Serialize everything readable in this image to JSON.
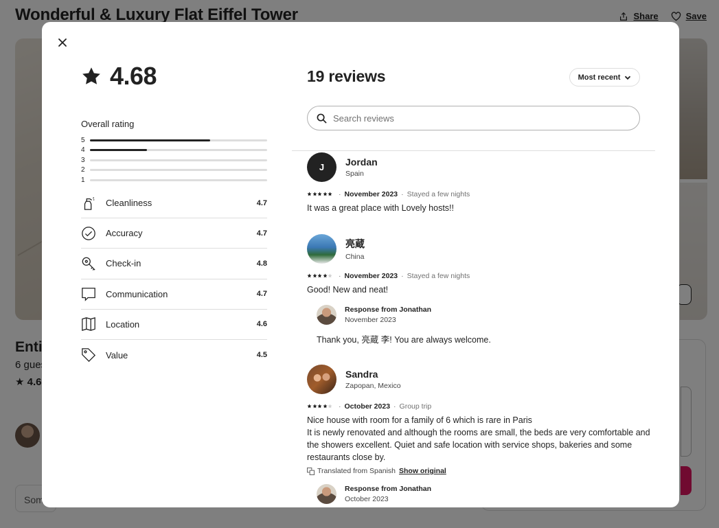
{
  "listing": {
    "title": "Wonderful & Luxury Flat Eiffel Tower",
    "share_label": "Share",
    "save_label": "Save",
    "entire_partial": "Entir",
    "guests_partial": "6 gues",
    "rating_partial": "4.6",
    "some_partial": "Som"
  },
  "modal": {
    "close_icon": "close-icon",
    "overall_score": "4.68",
    "overall_label": "Overall rating",
    "distribution": [
      {
        "stars": "5",
        "fraction": 0.68
      },
      {
        "stars": "4",
        "fraction": 0.32
      },
      {
        "stars": "3",
        "fraction": 0
      },
      {
        "stars": "2",
        "fraction": 0
      },
      {
        "stars": "1",
        "fraction": 0
      }
    ],
    "categories": [
      {
        "label": "Cleanliness",
        "value": "4.7",
        "icon": "spray-bottle-icon"
      },
      {
        "label": "Accuracy",
        "value": "4.7",
        "icon": "check-circle-icon"
      },
      {
        "label": "Check-in",
        "value": "4.8",
        "icon": "key-icon"
      },
      {
        "label": "Communication",
        "value": "4.7",
        "icon": "chat-bubble-icon"
      },
      {
        "label": "Location",
        "value": "4.6",
        "icon": "map-icon"
      },
      {
        "label": "Value",
        "value": "4.5",
        "icon": "tag-icon"
      }
    ],
    "review_count": "19 reviews",
    "sort_label": "Most recent",
    "search_placeholder": "Search reviews",
    "reviews": [
      {
        "avatar_letter": "J",
        "name": "Jordan",
        "location": "Spain",
        "rating": 5,
        "date": "November 2023",
        "stay": "Stayed a few nights",
        "text": [
          "It was a great place with Lovely hosts!!"
        ]
      },
      {
        "name": "亮蔵",
        "location": "China",
        "rating": 4,
        "date": "November 2023",
        "stay": "Stayed a few nights",
        "text": [
          "Good! New and neat!"
        ],
        "response": {
          "title": "Response from Jonathan",
          "date": "November 2023",
          "text": "Thank you, 亮蔵 李! You are always welcome."
        }
      },
      {
        "name": "Sandra",
        "location": "Zapopan, Mexico",
        "rating": 4,
        "date": "October 2023",
        "stay": "Group trip",
        "text": [
          "Nice house with room for a family of 6 which is rare in Paris",
          "It is newly renovated and although the rooms are small, the beds are very comfortable and the showers excellent. Quiet and safe location with service shops, bakeries and some restaurants close by."
        ],
        "translated": "Translated from Spanish",
        "show_original": "Show original",
        "response": {
          "title": "Response from Jonathan",
          "date": "October 2023"
        }
      }
    ]
  },
  "colors": {
    "text": "#222222",
    "muted": "#717171",
    "border": "#dddddd",
    "brand": "#e01561"
  }
}
